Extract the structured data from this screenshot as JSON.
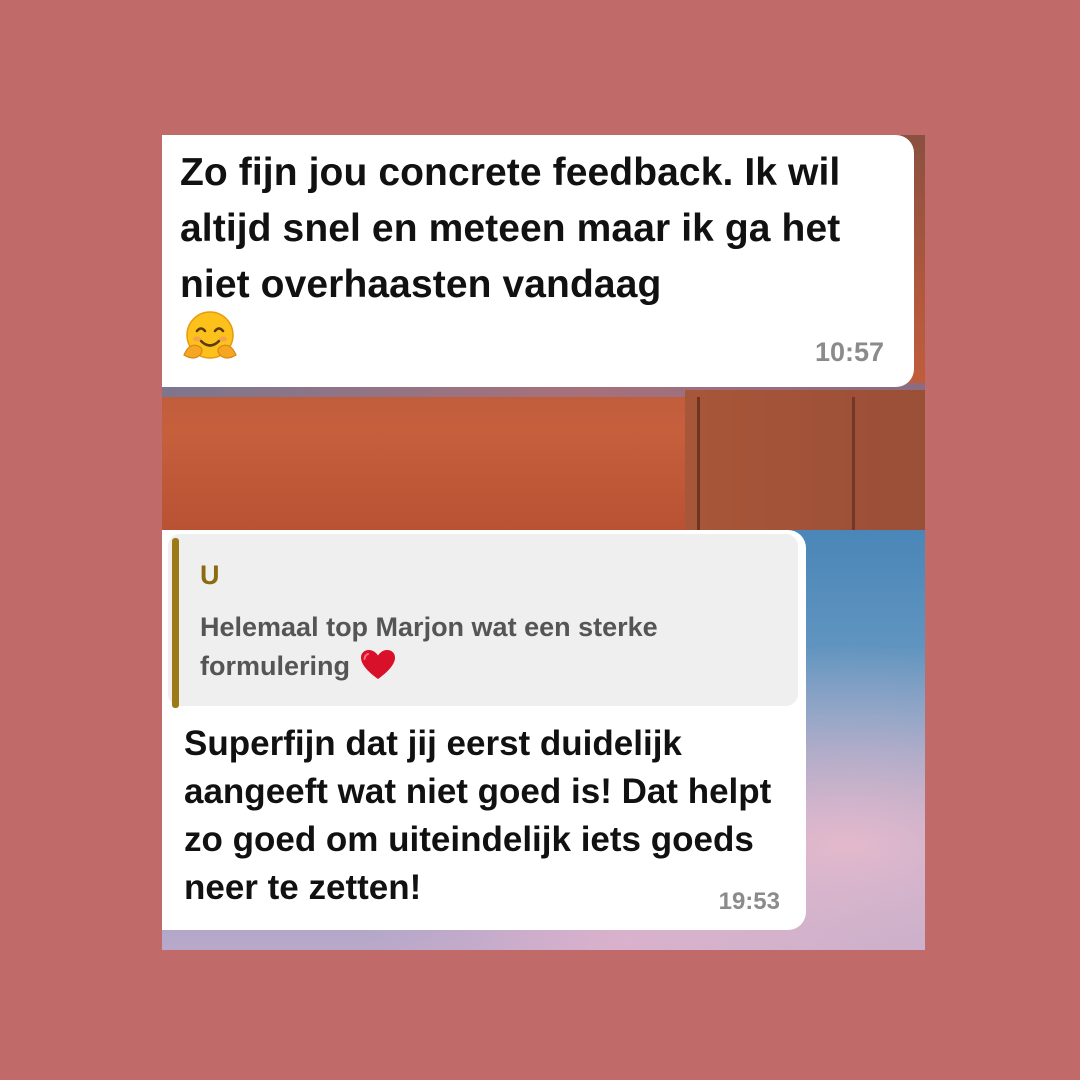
{
  "page": {
    "background_color": "#c06a69"
  },
  "message_one": {
    "text": "Zo fijn jou concrete feedback. Ik wil altijd snel en meteen maar ik ga het niet overhaasten vandaag",
    "emoji_icon": "hugging-face-emoji",
    "time": "10:57"
  },
  "message_two": {
    "quote": {
      "author": "U",
      "text": "Helemaal top Marjon wat een sterke formulering",
      "emoji_icon": "red-heart-emoji"
    },
    "text": "Superfijn dat jij eerst duidelijk aangeeft wat niet goed is! Dat helpt zo goed om uiteindelijk iets goeds neer te zetten!",
    "time": "19:53"
  }
}
